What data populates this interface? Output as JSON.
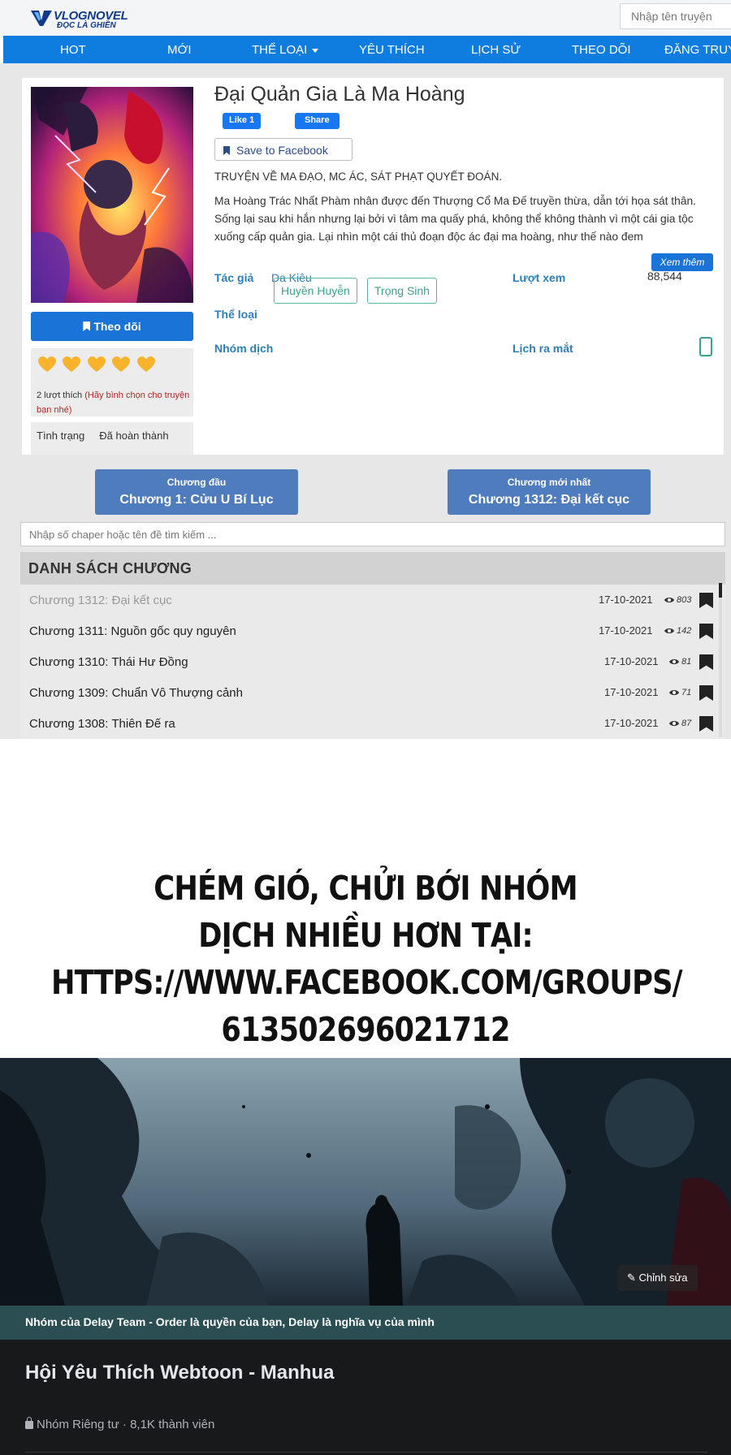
{
  "header": {
    "logo_name": "VLOGNOVEL",
    "logo_tagline": "ĐỌC LÀ GHIỀN",
    "search_placeholder": "Nhập tên truyện"
  },
  "nav": {
    "items": [
      "HOT",
      "MỚI",
      "THỂ LOẠI",
      "YÊU THÍCH",
      "LỊCH SỬ",
      "THEO DÕI",
      "ĐĂNG TRUY"
    ]
  },
  "story": {
    "title": "Đại Quản Gia Là Ma Hoàng",
    "fb_like": "Like 1",
    "fb_share": "Share",
    "save_fb": "Save to Facebook",
    "tagline": "TRUYỆN VỀ MA ĐẠO, MC ÁC, SÁT PHẠT QUYẾT ĐOÁN.",
    "description": "Ma Hoàng Trác Nhất Phàm nhân được đến Thượng Cổ Ma Đế truyền thừa, dẫn tới họa sát thân. Sống lại sau khi hắn nhưng lại bởi vì tâm ma quấy phá, không thể không thành vì một cái gia tộc xuống cấp quản gia. Lại nhìn một cái thủ đoạn độc ác đại ma hoàng, như thế nào đem",
    "more_label": "Xem thêm",
    "author_label": "Tác giả",
    "author": "Da Kiêu",
    "views_label": "Lượt xem",
    "views": "88,544",
    "genre_label": "Thể loại",
    "genres": [
      "Huyền Huyễn",
      "Trọng Sinh"
    ],
    "group_label": "Nhóm dịch",
    "schedule_label": "Lịch ra mắt",
    "follow_label": "Theo dõi",
    "likes_text": "2 lượt thích",
    "likes_hint": "(Hãy bình chọn cho truyện bạn nhé)",
    "status_label": "Tình trạng",
    "status_value": "Đã hoàn thành",
    "rating_hearts": 5
  },
  "chapters": {
    "first_small": "Chương đầu",
    "first_big": "Chương 1: Cửu U Bí Lục",
    "latest_small": "Chương mới nhất",
    "latest_big": "Chương 1312: Đại kết cục",
    "search_placeholder": "Nhập số chaper hoặc tên đề tìm kiếm ...",
    "list_title": "DANH SÁCH CHƯƠNG",
    "rows": [
      {
        "name": "Chương 1312: Đại kết cục",
        "date": "17-10-2021",
        "views": "803"
      },
      {
        "name": "Chương 1311: Nguồn gốc quy nguyên",
        "date": "17-10-2021",
        "views": "142"
      },
      {
        "name": "Chương 1310: Thái Hư Đồng",
        "date": "17-10-2021",
        "views": "81"
      },
      {
        "name": "Chương 1309: Chuẩn Vô Thượng cảnh",
        "date": "17-10-2021",
        "views": "71"
      },
      {
        "name": "Chương 1308: Thiên Đế ra",
        "date": "17-10-2021",
        "views": "87"
      }
    ]
  },
  "promo": {
    "lines": [
      "CHÉM GIÓ, CHỬI BỚI NHÓM",
      "DỊCH NHIỀU HƠN TẠI:",
      "HTTPS://WWW.FACEBOOK.COM/GROUPS/",
      "613502696021712"
    ]
  },
  "group": {
    "edit_label": "Chỉnh sửa",
    "description": "Nhóm của Delay Team - Order là quyền của bạn, Delay là nghĩa vụ của mình",
    "name": "Hội Yêu Thích Webtoon - Manhua",
    "meta": "Nhóm Riêng tư · 8,1K thành viên"
  },
  "colors": {
    "nav_blue": "#0f7ddf",
    "button_blue": "#4f7cbd",
    "heart": "#f7b32b",
    "link_teal": "#3aa28f",
    "fb_dark": "#18191a"
  }
}
